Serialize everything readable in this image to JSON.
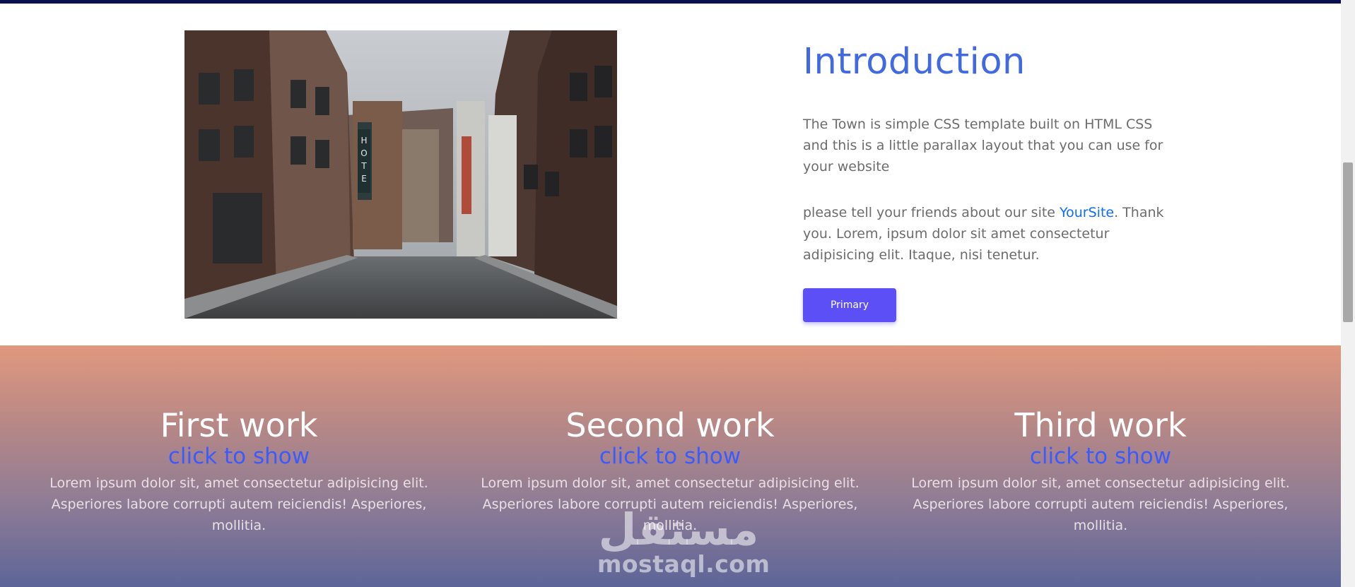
{
  "intro": {
    "image_alt": "Old town street with brick buildings and hotel sign",
    "title": "Introduction",
    "paragraph1": "The Town is simple CSS template built on HTML CSS and this is a little parallax layout that you can use for your website",
    "paragraph2_before": "please tell your friends about our site ",
    "link_text": "YourSite",
    "paragraph2_after": ". Thank you. Lorem, ipsum dolor sit amet consectetur adipisicing elit. Itaque, nisi tenetur.",
    "button_label": "Primary"
  },
  "works": [
    {
      "title": "First work",
      "link": "click to show",
      "desc": "Lorem ipsum dolor sit, amet consectetur adipisicing elit. Asperiores labore corrupti autem reiciendis! Asperiores, mollitia."
    },
    {
      "title": "Second work",
      "link": "click to show",
      "desc": "Lorem ipsum dolor sit, amet consectetur adipisicing elit. Asperiores labore corrupti autem reiciendis! Asperiores, mollitia."
    },
    {
      "title": "Third work",
      "link": "click to show",
      "desc": "Lorem ipsum dolor sit, amet consectetur adipisicing elit. Asperiores labore corrupti autem reiciendis! Asperiores, mollitia."
    }
  ],
  "watermark": {
    "arabic": "مستقل",
    "latin": "mostaql.com"
  },
  "colors": {
    "accent": "#4169e1",
    "button": "#5b4ff5",
    "link": "#0d6efd",
    "topbar": "#0a0f4f"
  },
  "icons": {
    "scrollbar": "scrollbar-thumb"
  }
}
